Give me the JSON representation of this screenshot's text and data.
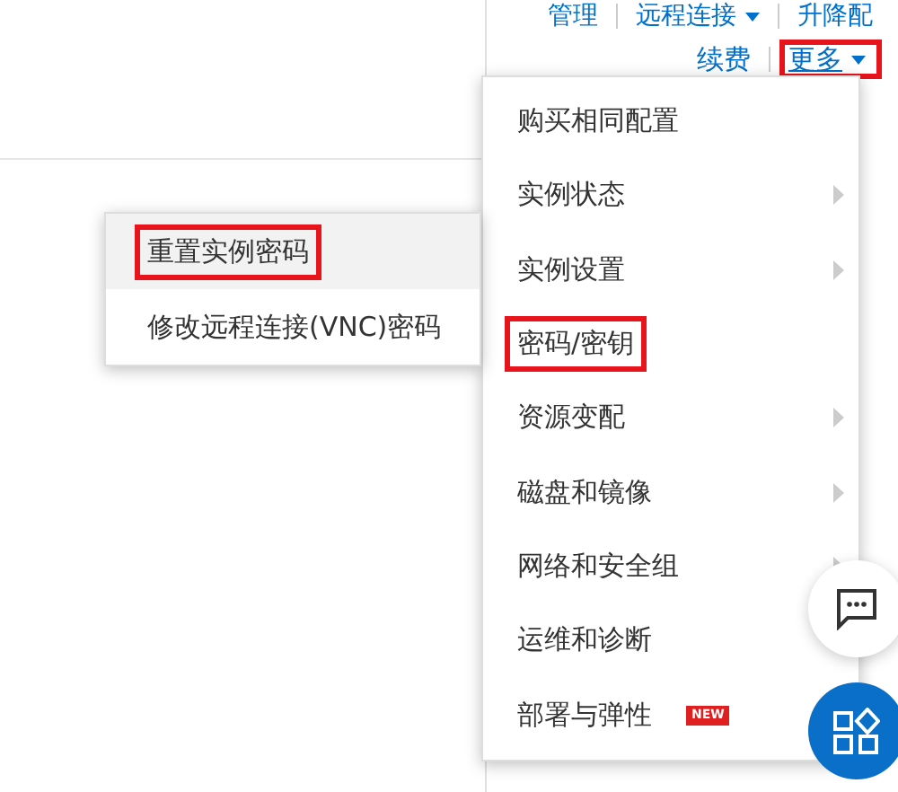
{
  "top_links": [
    {
      "label": "管理",
      "dropdown": false
    },
    {
      "label": "远程连接",
      "dropdown": true
    },
    {
      "label": "升降配",
      "dropdown": false
    }
  ],
  "actions": [
    {
      "label": "续费",
      "dropdown": false,
      "highlighted": false
    },
    {
      "label": "更多",
      "dropdown": true,
      "highlighted": true
    }
  ],
  "menu": {
    "items": [
      {
        "label": "购买相同配置",
        "has_submenu": false,
        "highlighted": false
      },
      {
        "label": "实例状态",
        "has_submenu": true,
        "highlighted": false
      },
      {
        "label": "实例设置",
        "has_submenu": true,
        "highlighted": false
      },
      {
        "label": "密码/密钥",
        "has_submenu": false,
        "highlighted": true
      },
      {
        "label": "资源变配",
        "has_submenu": true,
        "highlighted": false
      },
      {
        "label": "磁盘和镜像",
        "has_submenu": true,
        "highlighted": false
      },
      {
        "label": "网络和安全组",
        "has_submenu": true,
        "highlighted": false
      },
      {
        "label": "运维和诊断",
        "has_submenu": false,
        "highlighted": false
      },
      {
        "label": "部署与弹性",
        "has_submenu": false,
        "highlighted": false,
        "badge": "NEW"
      }
    ]
  },
  "submenu": {
    "items": [
      {
        "label": "重置实例密码",
        "selected": true,
        "highlighted": true
      },
      {
        "label": "修改远程连接(VNC)密码",
        "selected": false,
        "highlighted": false
      }
    ]
  },
  "floating_buttons": [
    {
      "kind": "chat"
    },
    {
      "kind": "apps"
    }
  ]
}
